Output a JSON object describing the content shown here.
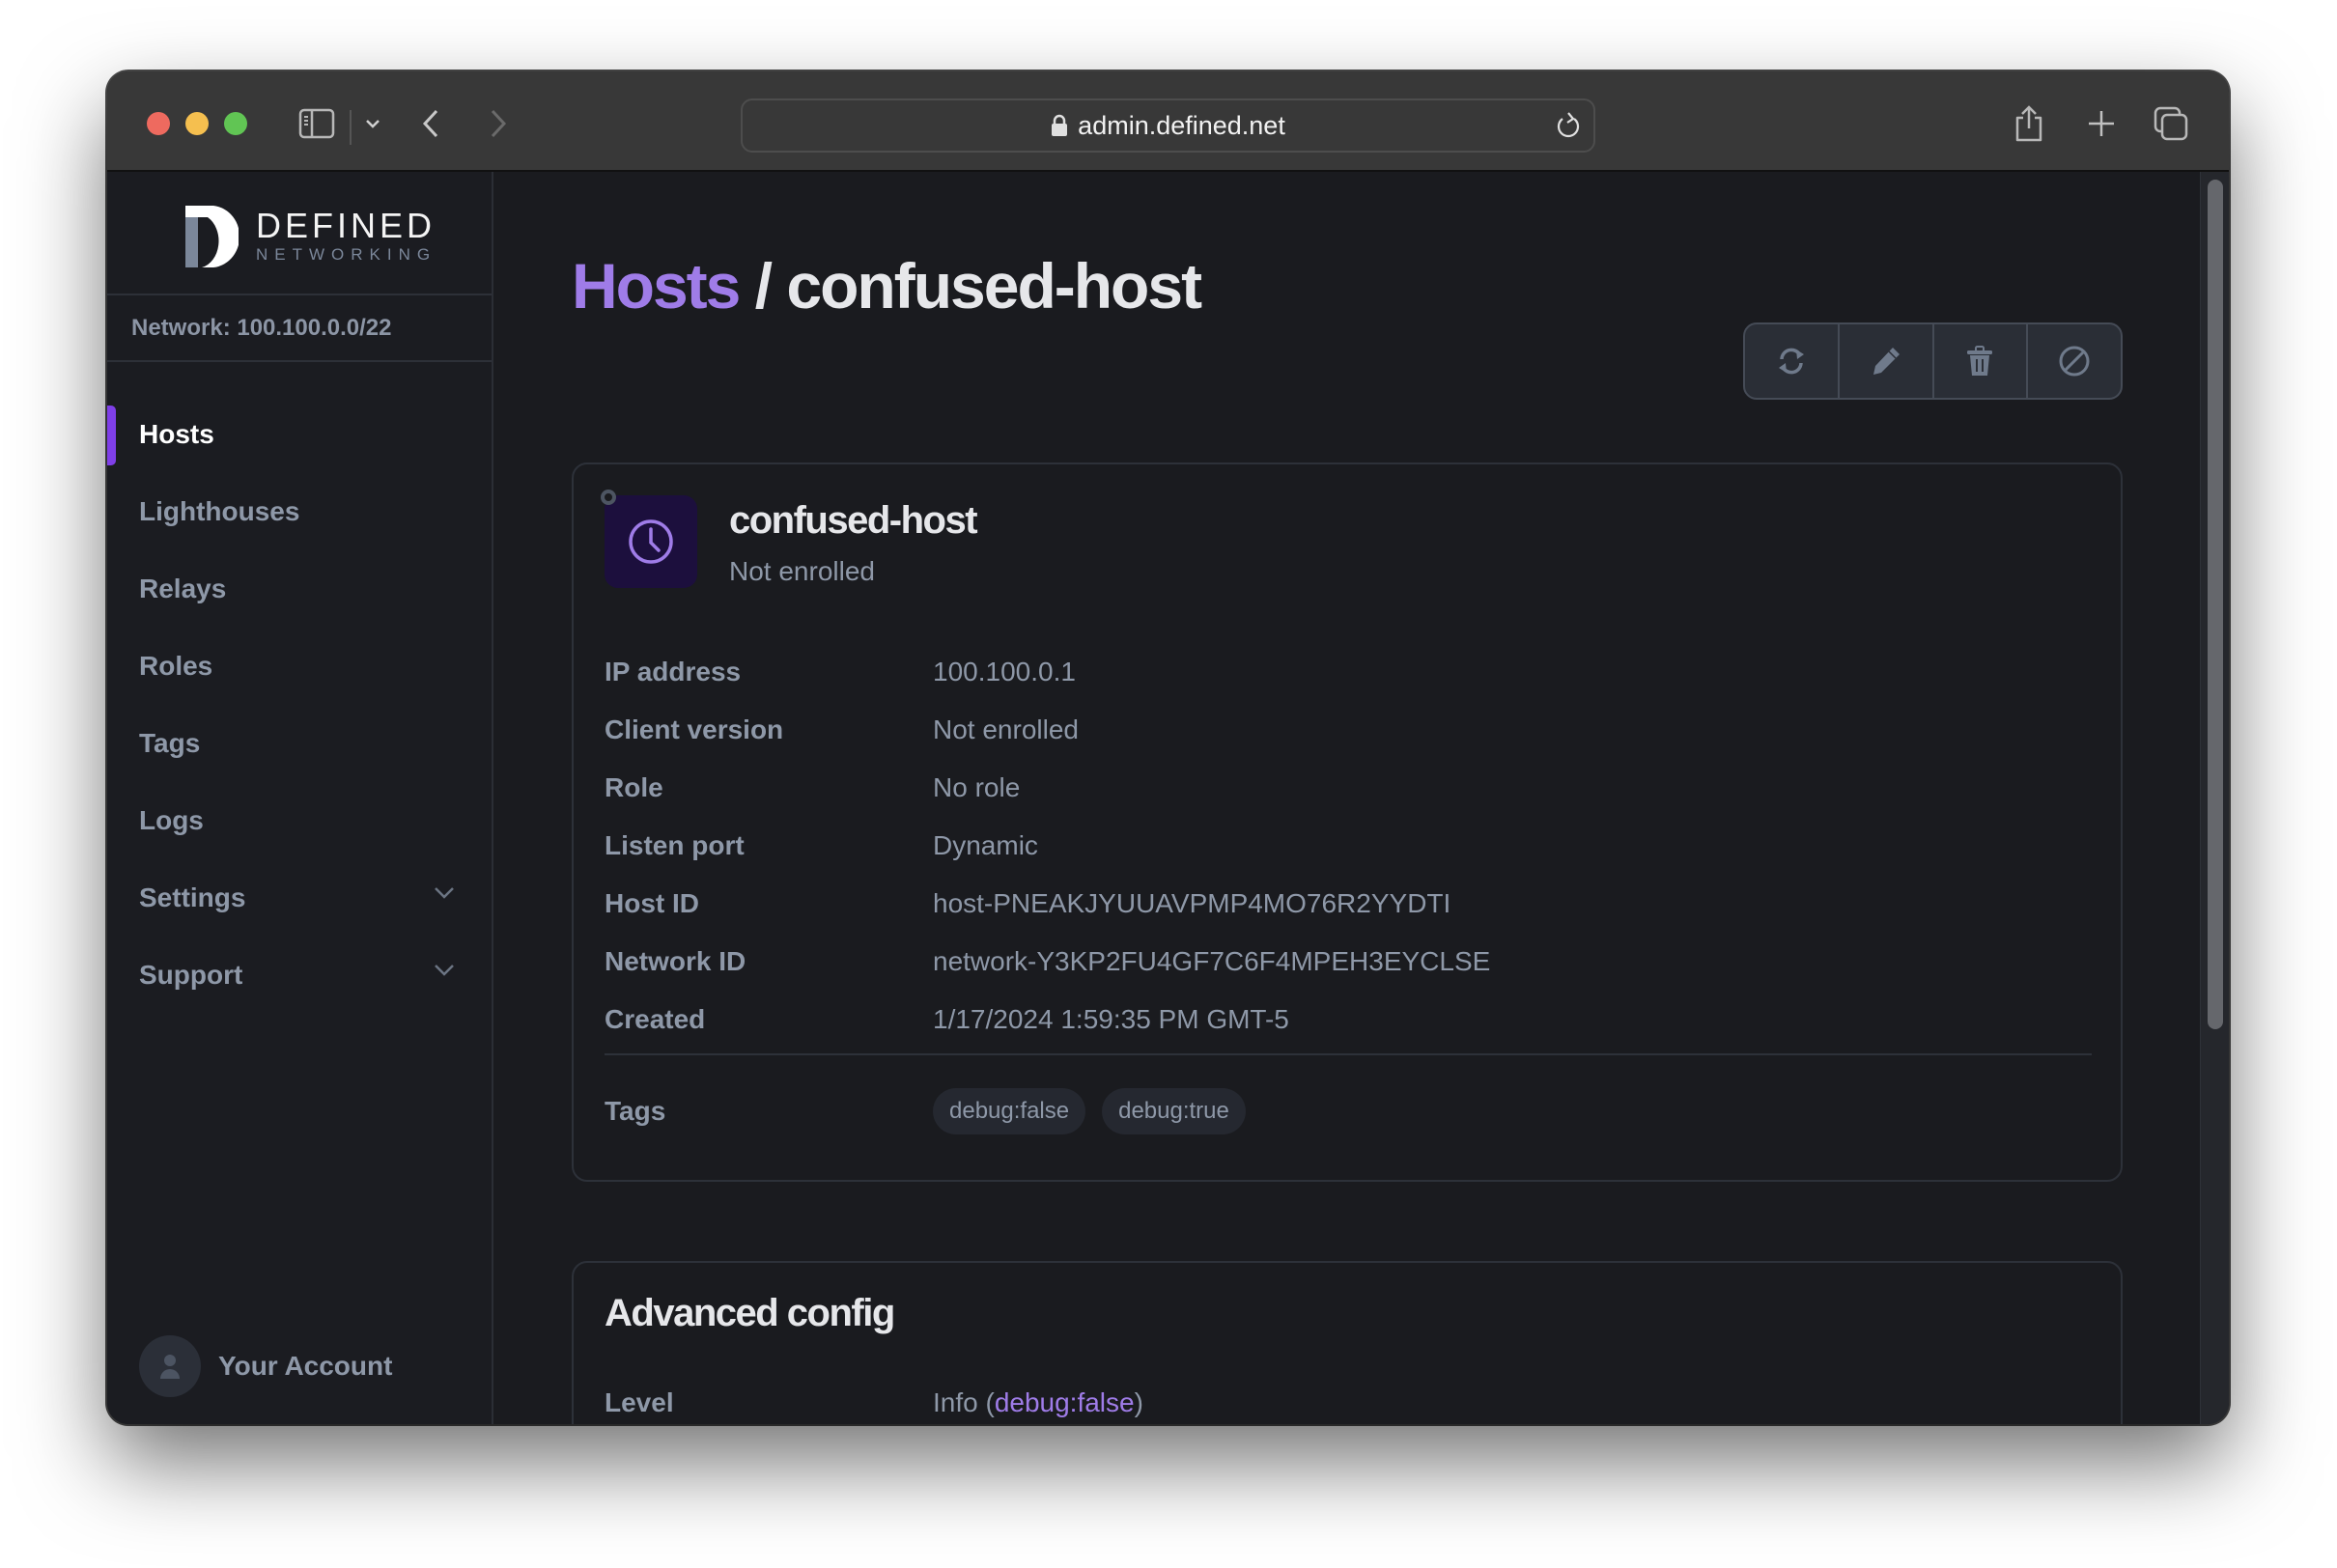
{
  "browser": {
    "url": "admin.defined.net",
    "icons": [
      "sidebar-toggle-icon",
      "chevron-down-icon",
      "back-icon",
      "forward-icon",
      "lock-icon",
      "reload-icon",
      "share-icon",
      "new-tab-icon",
      "tab-overview-icon"
    ]
  },
  "sidebar": {
    "logo_title": "DEFINED",
    "logo_subtitle": "NETWORKING",
    "network_label": "Network: 100.100.0.0/22",
    "items": [
      {
        "label": "Hosts",
        "active": true
      },
      {
        "label": "Lighthouses"
      },
      {
        "label": "Relays"
      },
      {
        "label": "Roles"
      },
      {
        "label": "Tags"
      },
      {
        "label": "Logs"
      },
      {
        "label": "Settings",
        "expandable": true
      },
      {
        "label": "Support",
        "expandable": true
      }
    ],
    "account_label": "Your Account"
  },
  "header": {
    "breadcrumb_parent": "Hosts",
    "separator": "/",
    "title": "confused-host",
    "actions": [
      "refresh",
      "edit",
      "delete",
      "block"
    ]
  },
  "host": {
    "name": "confused-host",
    "status": "Not enrolled",
    "details": [
      {
        "key": "IP address",
        "value": "100.100.0.1"
      },
      {
        "key": "Client version",
        "value": "Not enrolled"
      },
      {
        "key": "Role",
        "value": "No role"
      },
      {
        "key": "Listen port",
        "value": "Dynamic"
      },
      {
        "key": "Host ID",
        "value": "host-PNEAKJYUUAVPMP4MO76R2YYDTI"
      },
      {
        "key": "Network ID",
        "value": "network-Y3KP2FU4GF7C6F4MPEH3EYCLSE"
      },
      {
        "key": "Created",
        "value": "1/17/2024 1:59:35 PM GMT-5"
      }
    ],
    "tags_label": "Tags",
    "tags": [
      "debug:false",
      "debug:true"
    ]
  },
  "advanced": {
    "title": "Advanced config",
    "level_label": "Level",
    "level_value_prefix": "Info (",
    "level_link": "debug:false",
    "level_value_suffix": ")"
  },
  "colors": {
    "accent": "#9f7ce8",
    "active_indicator": "#7f3fe8",
    "background": "#1a1b1f"
  }
}
